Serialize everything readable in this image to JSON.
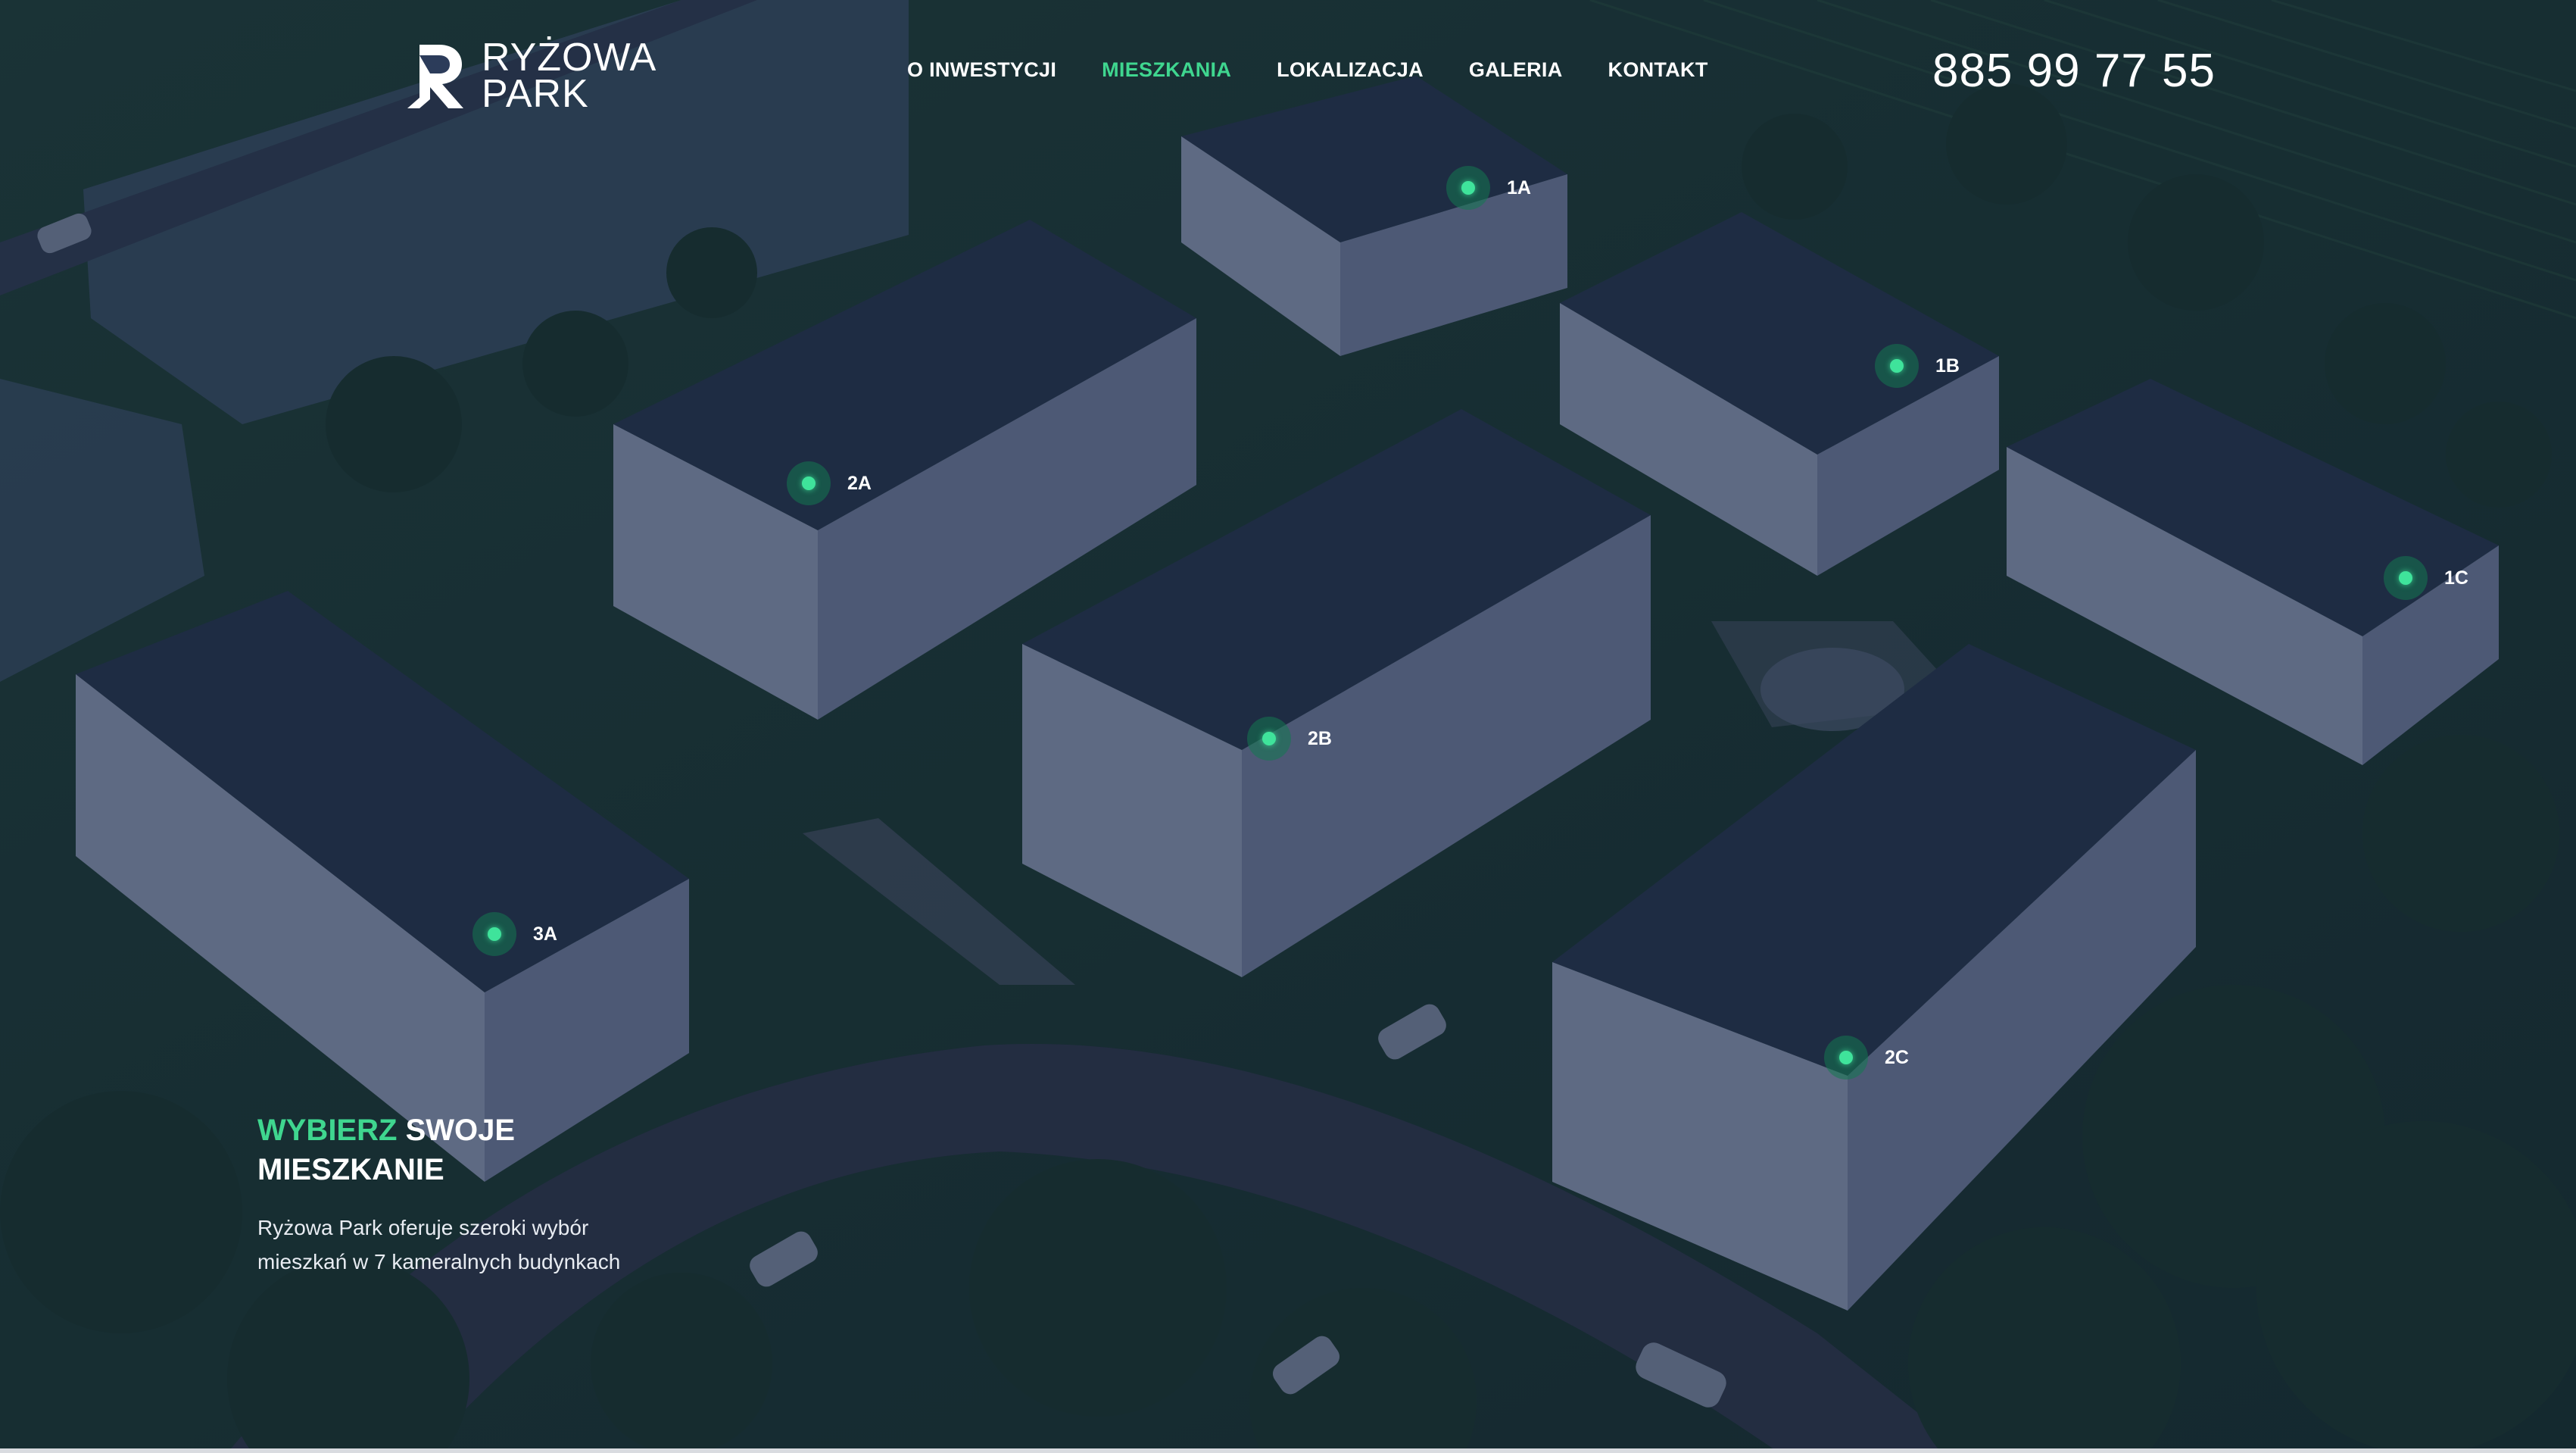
{
  "brand": {
    "line1": "RYŻOWA",
    "line2": "PARK"
  },
  "nav": {
    "items": [
      {
        "label": "O INWESTYCJI"
      },
      {
        "label": "MIESZKANIA"
      },
      {
        "label": "LOKALIZACJA"
      },
      {
        "label": "GALERIA"
      },
      {
        "label": "KONTAKT"
      }
    ],
    "active": "MIESZKANIA"
  },
  "phone": "885 99 77 55",
  "buildings": [
    {
      "label": "1A"
    },
    {
      "label": "1B"
    },
    {
      "label": "1C"
    },
    {
      "label": "2A"
    },
    {
      "label": "2B"
    },
    {
      "label": "2C"
    },
    {
      "label": "3A"
    }
  ],
  "hero": {
    "title_accent": "WYBIERZ",
    "title_rest_1": "SWOJE",
    "title_rest_2": "MIESZKANIE",
    "description": "Ryżowa Park oferuje szeroki wybór mieszkań w 7 kameralnych budynkach"
  },
  "colors": {
    "accent": "#3fd68f",
    "overlay": "#18284a",
    "text": "#ffffff"
  },
  "icons": {
    "logo": "logo-r-mark-icon",
    "marker": "building-marker-icon"
  }
}
